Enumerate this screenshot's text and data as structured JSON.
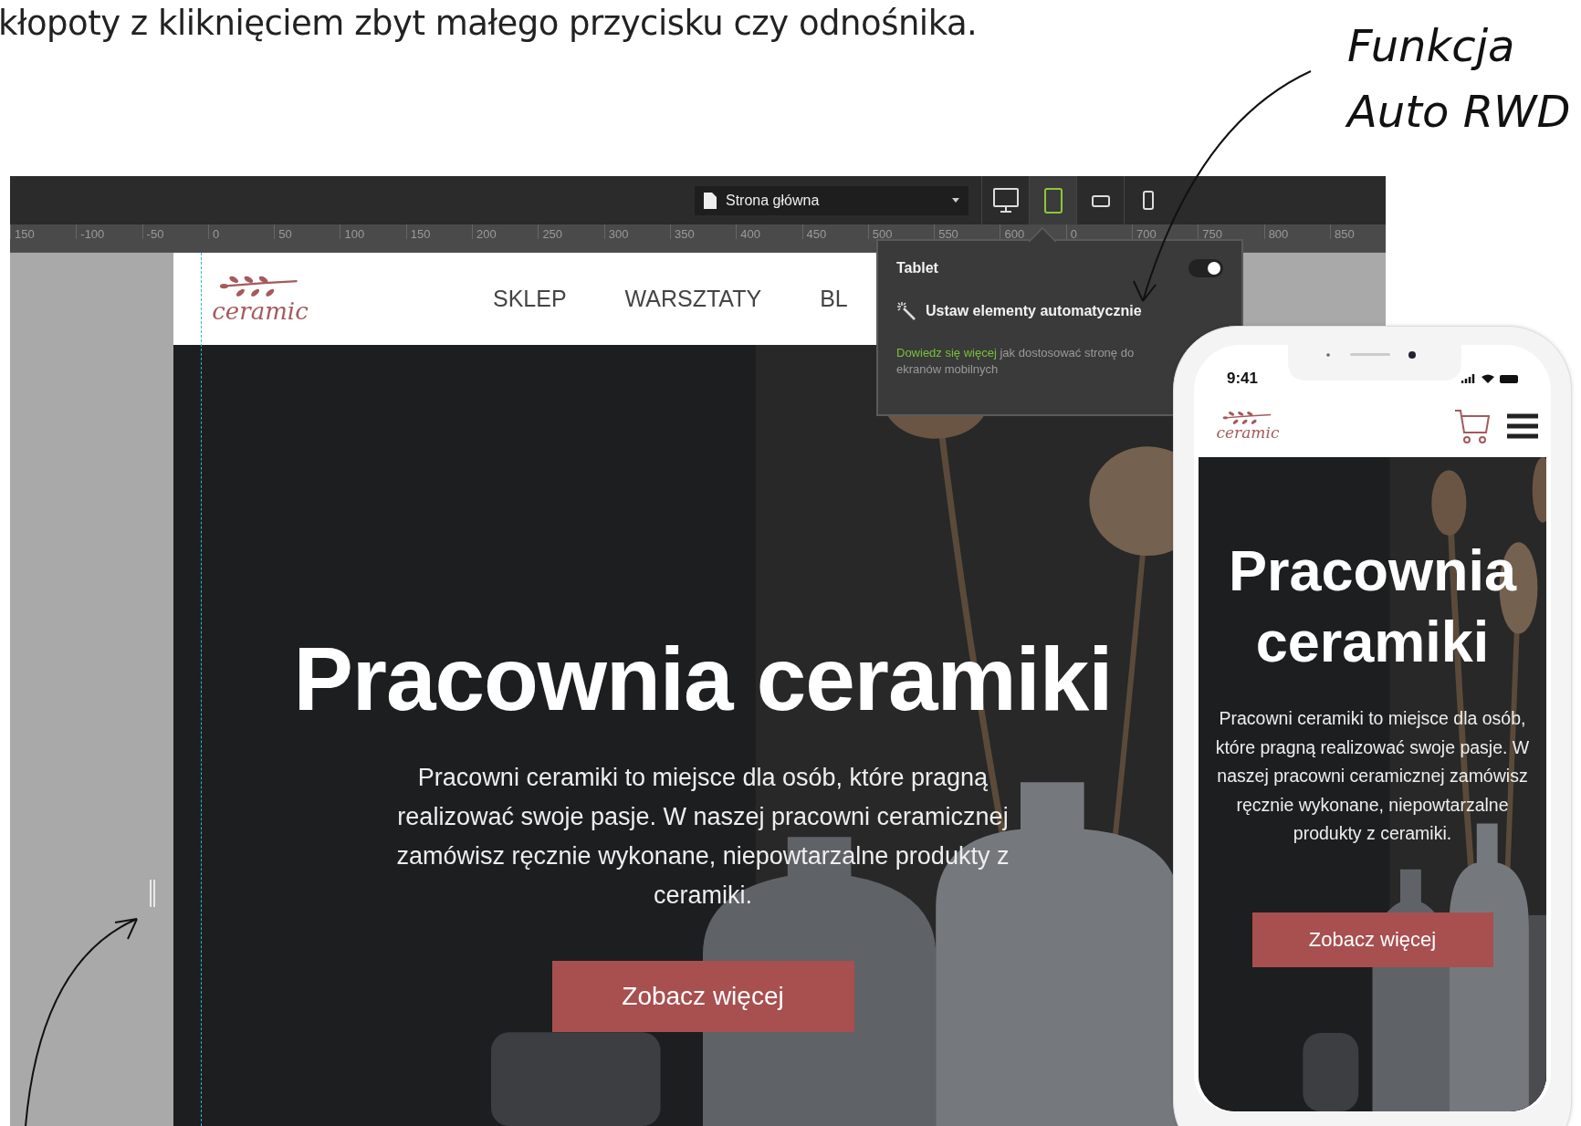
{
  "article_text": "kłopoty z kliknięciem zbyt małego przycisku czy odnośnika.",
  "annotation": [
    "Funkcja",
    "Auto RWD"
  ],
  "editor": {
    "page_select": "Strona główna",
    "devices": [
      {
        "kind": "desktop",
        "selected": false
      },
      {
        "kind": "tablet",
        "selected": true
      },
      {
        "kind": "landscape",
        "selected": false
      },
      {
        "kind": "phone",
        "selected": false
      }
    ],
    "ruler": [
      "150",
      "-100",
      "-50",
      "0",
      "50",
      "100",
      "150",
      "200",
      "250",
      "300",
      "350",
      "400",
      "450",
      "500",
      "550",
      "600",
      "0",
      "700",
      "750",
      "800",
      "850"
    ]
  },
  "popup": {
    "title": "Tablet",
    "toggle_on": true,
    "action": "Ustaw elementy automatycznie",
    "link": "Dowiedz się więcej",
    "help": "jak dostosować stronę do ekranów mobilnych"
  },
  "site": {
    "logo": "ceramic",
    "nav": [
      "SKLEP",
      "WARSZTATY",
      "BL"
    ],
    "hero_title": "Pracownia ceramiki",
    "hero_text": "Pracowni ceramiki to miejsce dla osób, które pragną realizować swoje pasje. W naszej pracowni ceramicznej zamówisz ręcznie wykonane, niepowtarzalne produkty z ceramiki.",
    "button": "Zobacz więcej"
  },
  "phone": {
    "time": "9:41",
    "logo": "ceramic",
    "hero_title": "Pracownia ceramiki",
    "hero_text": "Pracowni ceramiki to miejsce dla osób, które pragną realizować swoje pasje. W naszej pracowni ceramicznej zamówisz ręcznie wykonane, niepowtarzalne produkty z ceramiki.",
    "button": "Zobacz więcej"
  }
}
